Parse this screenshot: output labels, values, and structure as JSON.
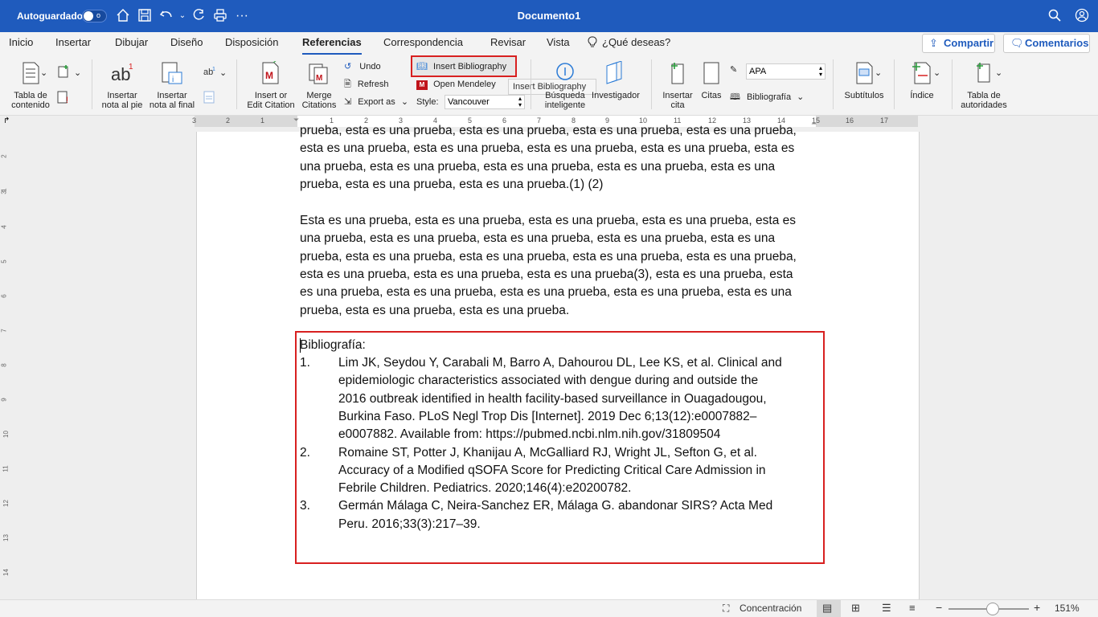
{
  "titlebar": {
    "autosave_label": "Autoguardado",
    "autosave_state": "o",
    "document_title": "Documento1"
  },
  "tabs": [
    {
      "label": "Inicio"
    },
    {
      "label": "Insertar"
    },
    {
      "label": "Dibujar"
    },
    {
      "label": "Diseño"
    },
    {
      "label": "Disposición"
    },
    {
      "label": "Referencias"
    },
    {
      "label": "Correspondencia"
    },
    {
      "label": "Revisar"
    },
    {
      "label": "Vista"
    },
    {
      "label": "¿Qué deseas?"
    }
  ],
  "active_tab": "Referencias",
  "share_label": "Compartir",
  "comments_label": "Comentarios",
  "ribbon": {
    "toc_label_1": "Tabla de",
    "toc_label_2": "contenido",
    "footnote_label_1": "Insertar",
    "footnote_label_2": "nota al pie",
    "endnote_label_1": "Insertar",
    "endnote_label_2": "nota al final",
    "insert_citation_1": "Insert or",
    "insert_citation_2": "Edit Citation",
    "merge_citations_1": "Merge",
    "merge_citations_2": "Citations",
    "undo": "Undo",
    "refresh": "Refresh",
    "export_as": "Export as",
    "insert_bibliography": "Insert Bibliography",
    "open_mendeley": "Open Mendeley",
    "style_label": "Style:",
    "style_value": "Vancouver",
    "tooltip": "Insert Bibliography",
    "smart_lookup_1": "Búsqueda",
    "smart_lookup_2": "inteligente",
    "researcher": "Investigador",
    "insert_cite_1": "Insertar",
    "insert_cite_2": "cita",
    "citations": "Citas",
    "style_apa": "APA",
    "bibliography": "Bibliografía",
    "captions": "Subtítulos",
    "index": "Índice",
    "toa_1": "Tabla de",
    "toa_2": "autoridades"
  },
  "ruler_h": [
    "3",
    "2",
    "1",
    "1",
    "2",
    "3",
    "4",
    "5",
    "6",
    "7",
    "8",
    "9",
    "10",
    "11",
    "12",
    "13",
    "14",
    "15",
    "16",
    "17"
  ],
  "ruler_v": [
    "2",
    "1",
    "3",
    "4",
    "5",
    "6",
    "7",
    "8",
    "9",
    "10",
    "11",
    "12",
    "13",
    "14"
  ],
  "document": {
    "para1_lines": [
      "prueba, esta es una prueba, esta es una prueba, esta es una prueba, esta es una prueba,",
      "esta es una prueba, esta es una prueba, esta es una prueba, esta es una prueba, esta es",
      "una prueba, esta es una prueba, esta es una prueba, esta es una prueba, esta es una",
      "prueba, esta es una prueba, esta es una prueba.(1) (2)"
    ],
    "para2_lines": [
      "Esta es una prueba, esta es una prueba, esta es una prueba, esta es una prueba, esta es",
      "una prueba, esta es una prueba, esta es una prueba, esta es una prueba, esta es una",
      "prueba, esta es una prueba, esta es una prueba, esta es una prueba, esta es una prueba,",
      "esta es una prueba, esta es una prueba, esta es una prueba(3), esta es una prueba, esta",
      "es una prueba, esta es una prueba, esta es una prueba, esta es una prueba, esta es una",
      "prueba, esta es una prueba, esta es una prueba."
    ],
    "bibliography_heading": "Bibliografía:",
    "references": [
      {
        "num": "1.",
        "lines": [
          "Lim JK, Seydou Y, Carabali M, Barro A, Dahourou DL, Lee KS, et al. Clinical and",
          "epidemiologic characteristics associated with dengue during and outside the",
          "2016 outbreak identified in health facility-based surveillance in Ouagadougou,",
          "Burkina Faso. PLoS Negl Trop Dis [Internet]. 2019 Dec 6;13(12):e0007882–",
          "e0007882. Available from: https://pubmed.ncbi.nlm.nih.gov/31809504"
        ]
      },
      {
        "num": "2.",
        "lines": [
          "Romaine ST, Potter J, Khanijau A, McGalliard RJ, Wright JL, Sefton G, et al.",
          "Accuracy of a Modified qSOFA Score for Predicting Critical Care Admission in",
          "Febrile Children. Pediatrics. 2020;146(4):e20200782."
        ]
      },
      {
        "num": "3.",
        "lines": [
          "Germán Málaga C, Neira-Sanchez ER, Málaga G. abandonar SIRS? Acta Med",
          "Peru. 2016;33(3):217–39."
        ]
      }
    ]
  },
  "status": {
    "focus_label": "Concentración",
    "zoom": "151%",
    "zoom_level_fraction": 0.55
  },
  "colors": {
    "titlebar": "#1f5bbd",
    "highlight_border": "#d82020",
    "mendeley_red": "#c0141b"
  }
}
